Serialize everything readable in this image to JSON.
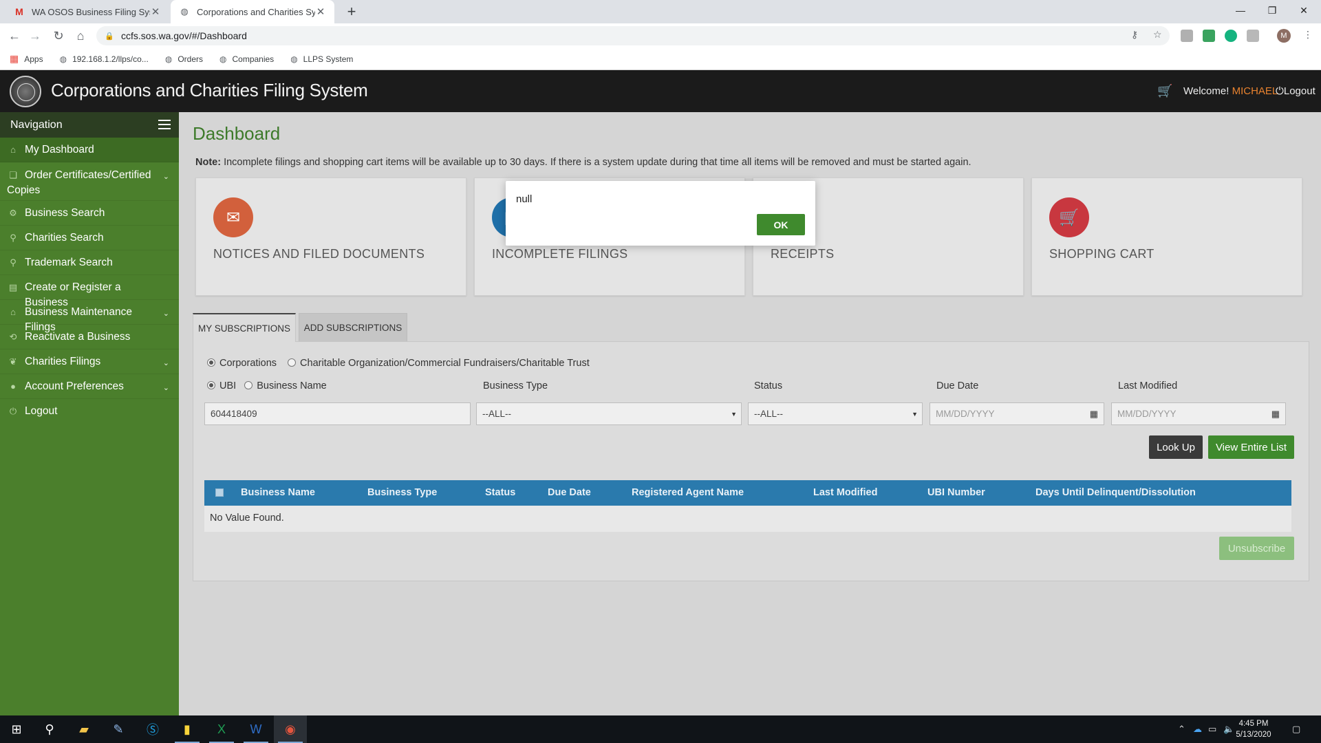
{
  "browser": {
    "tabs": [
      {
        "title": "WA OSOS Business Filing System",
        "icon": "gmail-icon"
      },
      {
        "title": "Corporations and Charities Syste",
        "icon": "globe-icon"
      }
    ],
    "url": "ccfs.sos.wa.gov/#/Dashboard",
    "bookmarks": [
      "Apps",
      "192.168.1.2/llps/co...",
      "Orders",
      "Companies",
      "LLPS System"
    ],
    "profile_initial": "M"
  },
  "header": {
    "title": "Corporations and Charities Filing System",
    "welcome": "Welcome!",
    "user": "MICHAEL",
    "logout": "Logout"
  },
  "sidebar": {
    "title": "Navigation",
    "items": [
      {
        "label": "My Dashboard",
        "icon": "home-icon",
        "expandable": false
      },
      {
        "label": "Order Certificates/Certified",
        "label2": "Copies",
        "icon": "certificate-icon",
        "expandable": true
      },
      {
        "label": "Business Search",
        "icon": "business-search-icon",
        "expandable": false
      },
      {
        "label": "Charities Search",
        "icon": "search-icon",
        "expandable": false
      },
      {
        "label": "Trademark Search",
        "icon": "search-icon",
        "expandable": false
      },
      {
        "label": "Create or Register a Business",
        "icon": "building-icon",
        "expandable": false
      },
      {
        "label": "Business Maintenance Filings",
        "icon": "institution-icon",
        "expandable": true
      },
      {
        "label": "Reactivate a Business",
        "icon": "reactivate-icon",
        "expandable": false
      },
      {
        "label": "Charities Filings",
        "icon": "charity-icon",
        "expandable": true
      },
      {
        "label": "Account Preferences",
        "icon": "user-icon",
        "expandable": true
      },
      {
        "label": "Logout",
        "icon": "power-icon",
        "expandable": false
      }
    ]
  },
  "main": {
    "title": "Dashboard",
    "note_label": "Note:",
    "note_text": "Incomplete filings and shopping cart items will be available up to 30 days. If there is a system update during that time all items will be removed and must be started again.",
    "cards": [
      {
        "label": "NOTICES AND FILED DOCUMENTS",
        "icon": "envelope-icon",
        "color": "#d2603c"
      },
      {
        "label": "INCOMPLETE FILINGS",
        "icon": "document-icon",
        "color": "#1f6fa8"
      },
      {
        "label": "RECEIPTS",
        "icon": "receipt-icon",
        "color": "#3f8a2d"
      },
      {
        "label": "SHOPPING CART",
        "icon": "cart-icon",
        "color": "#c8373f"
      }
    ],
    "subs": {
      "tab_my": "MY SUBSCRIPTIONS",
      "tab_add": "ADD SUBSCRIPTIONS",
      "radio_corp": "Corporations",
      "radio_charity": "Charitable Organization/Commercial Fundraisers/Charitable Trust",
      "radio_ubi": "UBI",
      "radio_bname": "Business Name",
      "label_btype": "Business Type",
      "label_status": "Status",
      "label_due": "Due Date",
      "label_modified": "Last Modified",
      "ubi_value": "604418409",
      "btype_value": "--ALL--",
      "status_value": "--ALL--",
      "date_placeholder": "MM/DD/YYYY",
      "lookup": "Look Up",
      "view_all": "View Entire List",
      "columns": [
        "Business Name",
        "Business Type",
        "Status",
        "Due Date",
        "Registered Agent Name",
        "Last Modified",
        "UBI Number",
        "Days Until Delinquent/Dissolution"
      ],
      "empty": "No Value Found.",
      "unsubscribe": "Unsubscribe"
    }
  },
  "dialog": {
    "message": "null",
    "ok": "OK"
  },
  "taskbar": {
    "time": "4:45 PM",
    "date": "5/13/2020"
  },
  "colors": {
    "accent_green": "#3f8a2d",
    "sidebar_green": "#4b7f2c",
    "table_blue": "#2a7aad",
    "username_orange": "#e8822f"
  }
}
